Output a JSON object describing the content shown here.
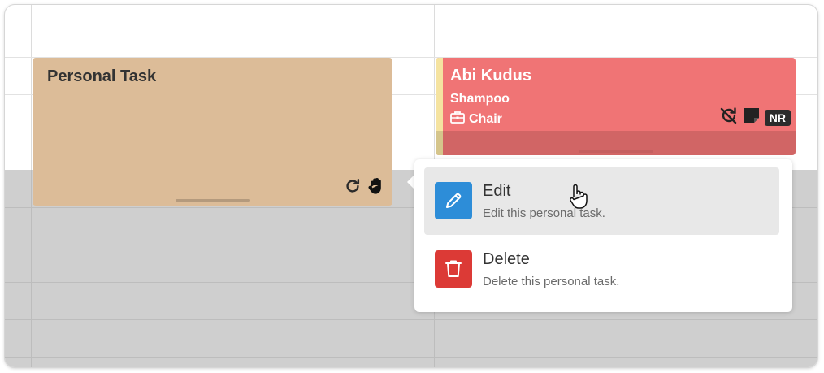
{
  "colors": {
    "personal_task_bg": "#dcbc98",
    "appointment_bg": "#f07475",
    "appointment_stripe": "#f5e3a0",
    "edit_icon_bg": "#2d8dd8",
    "delete_icon_bg": "#dc3a36",
    "nr_badge_bg": "#2c2c2c"
  },
  "personal_task": {
    "title": "Personal Task",
    "icons": [
      "recurring-icon",
      "hand-icon"
    ]
  },
  "appointment": {
    "client_name": "Abi Kudus",
    "service": "Shampoo",
    "resource": "Chair",
    "resource_icon": "briefcase-icon",
    "icons": [
      "no-recurring-icon",
      "note-icon"
    ],
    "badge": "NR"
  },
  "context_menu": {
    "items": [
      {
        "label": "Edit",
        "description": "Edit this personal task.",
        "icon": "pencil-icon",
        "hovered": true
      },
      {
        "label": "Delete",
        "description": "Delete this personal task.",
        "icon": "trash-icon",
        "hovered": false
      }
    ]
  }
}
